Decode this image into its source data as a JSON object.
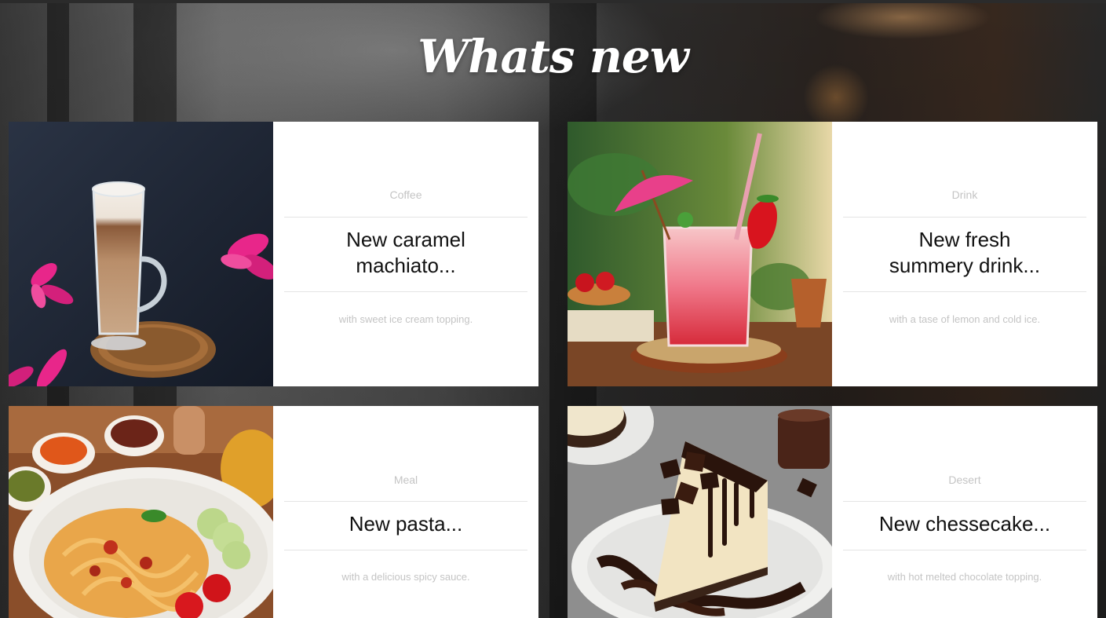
{
  "page": {
    "heading": "Whats new"
  },
  "items": [
    {
      "category": "Coffee",
      "title_line1": "New caramel",
      "title_line2": "machiato...",
      "description": "with sweet ice cream topping.",
      "image": "latte-glass-on-coaster"
    },
    {
      "category": "Drink",
      "title_line1": "New fresh",
      "title_line2": "summery drink...",
      "description": "with a tase of lemon and cold ice.",
      "image": "strawberry-cocktail"
    },
    {
      "category": "Meal",
      "title_line1": "New pasta...",
      "title_line2": "",
      "description": "with a delicious spicy sauce.",
      "image": "pasta-plate"
    },
    {
      "category": "Desert",
      "title_line1": "New chessecake...",
      "title_line2": "",
      "description": "with hot melted chocolate topping.",
      "image": "chocolate-cheesecake-slice"
    }
  ],
  "colors": {
    "heading": "#ffffff",
    "card_bg": "#ffffff",
    "category_text": "#c4c4c4",
    "title_text": "#111111",
    "divider": "#e4e4e4"
  }
}
